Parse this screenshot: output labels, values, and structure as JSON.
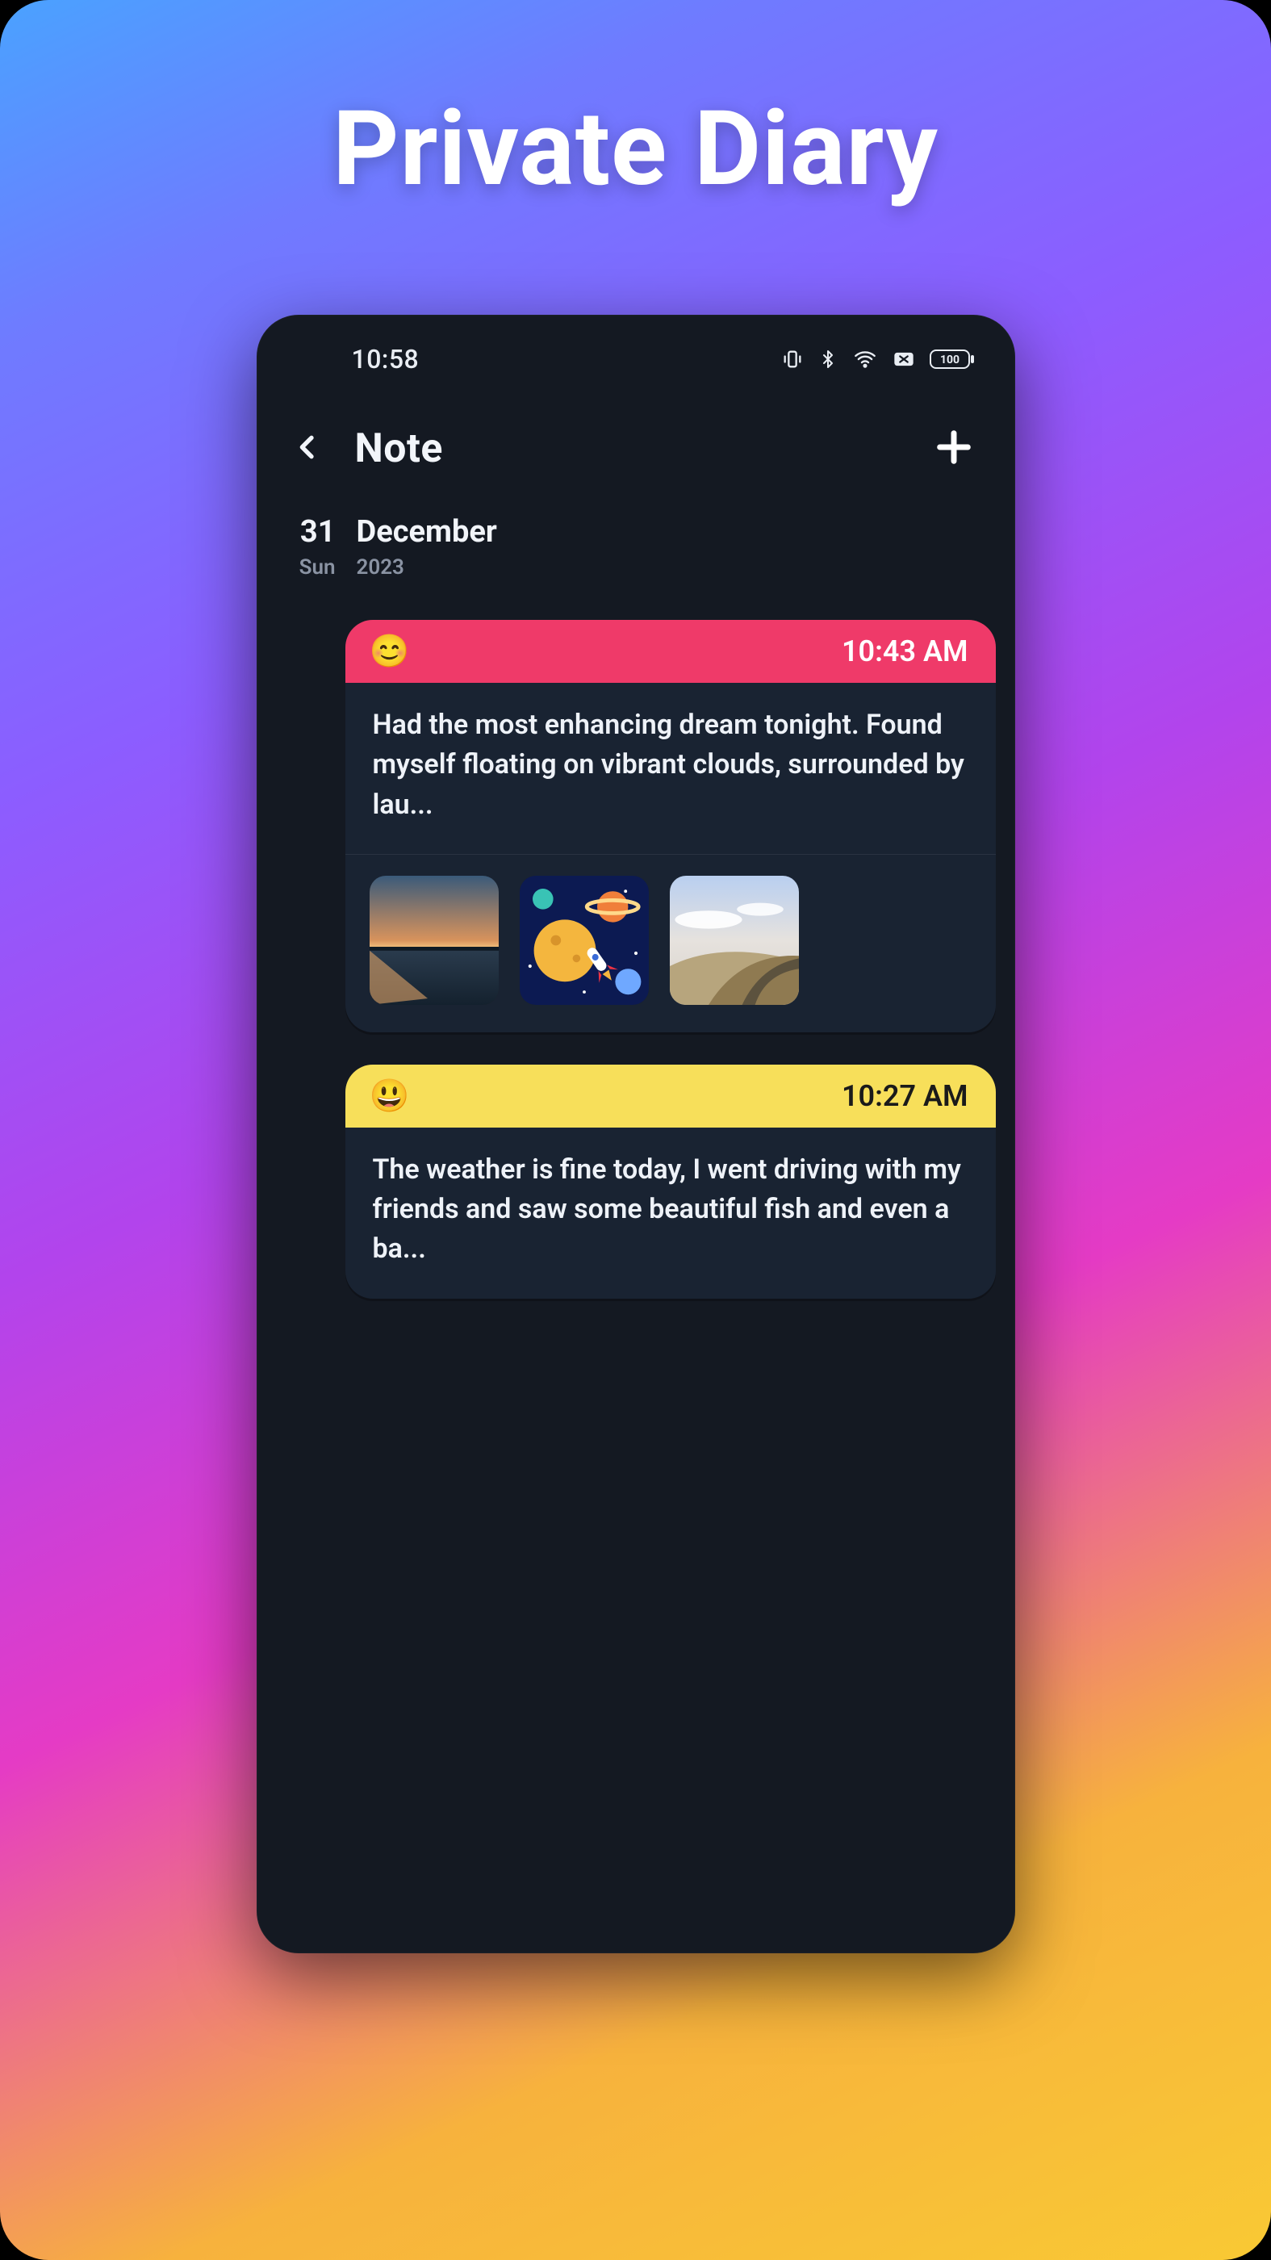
{
  "promo": {
    "title": "Private Diary"
  },
  "statusbar": {
    "time": "10:58",
    "battery_pct": "100"
  },
  "appbar": {
    "title": "Note"
  },
  "date": {
    "day_num": "31",
    "weekday": "Sun",
    "month": "December",
    "year": "2023"
  },
  "entries": [
    {
      "header_style": "pink",
      "mood_emoji": "😊",
      "time": "10:43 AM",
      "body": "Had the most enhancing dream tonight. Found myself floating on vibrant clouds, surrounded  by lau..."
    },
    {
      "header_style": "yellow",
      "mood_emoji": "😃",
      "time": "10:27 AM",
      "body": "The weather is fine today, I went driving with my friends and saw some beautiful fish and even a ba..."
    }
  ]
}
